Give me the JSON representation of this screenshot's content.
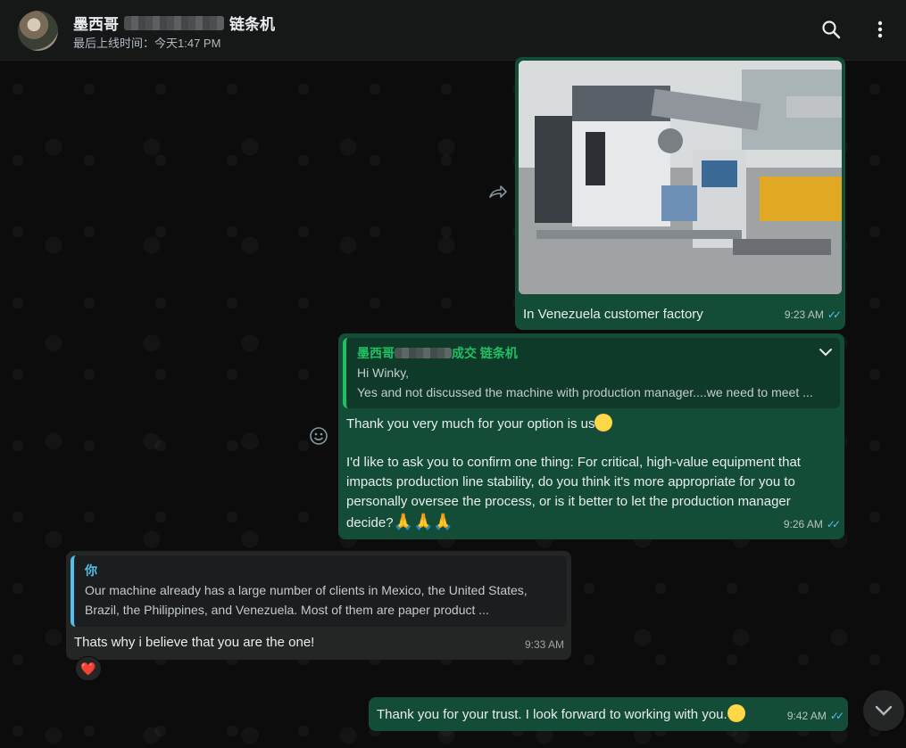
{
  "header": {
    "contact_name_prefix": "墨西哥",
    "contact_name_suffix": "链条机",
    "last_seen": "最后上线时间：今天1:47 PM"
  },
  "messages": {
    "photo_caption": "In Venezuela customer factory",
    "photo_time": "9:23 AM",
    "reply1": {
      "quote_author_prefix": "墨西哥",
      "quote_author_suffix": "成交 链条机",
      "quote_line1": "Hi Winky,",
      "quote_line2": "Yes  and not  discussed the machine with production manager....we need to meet ...",
      "text_line1": "Thank you very much for your option is us",
      "text_para2": "I'd like to ask you to confirm one thing: For critical, high-value equipment that impacts production line stability, do you think it's more appropriate for you to personally oversee the process, or is it better to let the production manager decide?",
      "time": "9:26 AM"
    },
    "incoming": {
      "quote_author": "你",
      "quote_text": "Our machine already has a large number of clients in Mexico, the United States, Brazil, the Philippines, and Venezuela. Most of them are paper product ...",
      "text": "Thats why i believe that you are the one!",
      "time": "9:33 AM",
      "reaction": "❤️"
    },
    "last": {
      "text": "Thank you for your trust. I look forward to working with you.",
      "time": "9:42 AM"
    }
  },
  "icons": {
    "search": "search-icon",
    "menu": "menu-icon",
    "forward": "forward-icon",
    "emoji": "emoji-icon",
    "scroll": "chevron-down-icon"
  },
  "colors": {
    "outgoing_bubble": "#144d37",
    "incoming_bubble": "#242626",
    "accent_green": "#21c063",
    "accent_blue": "#53bdeb"
  }
}
